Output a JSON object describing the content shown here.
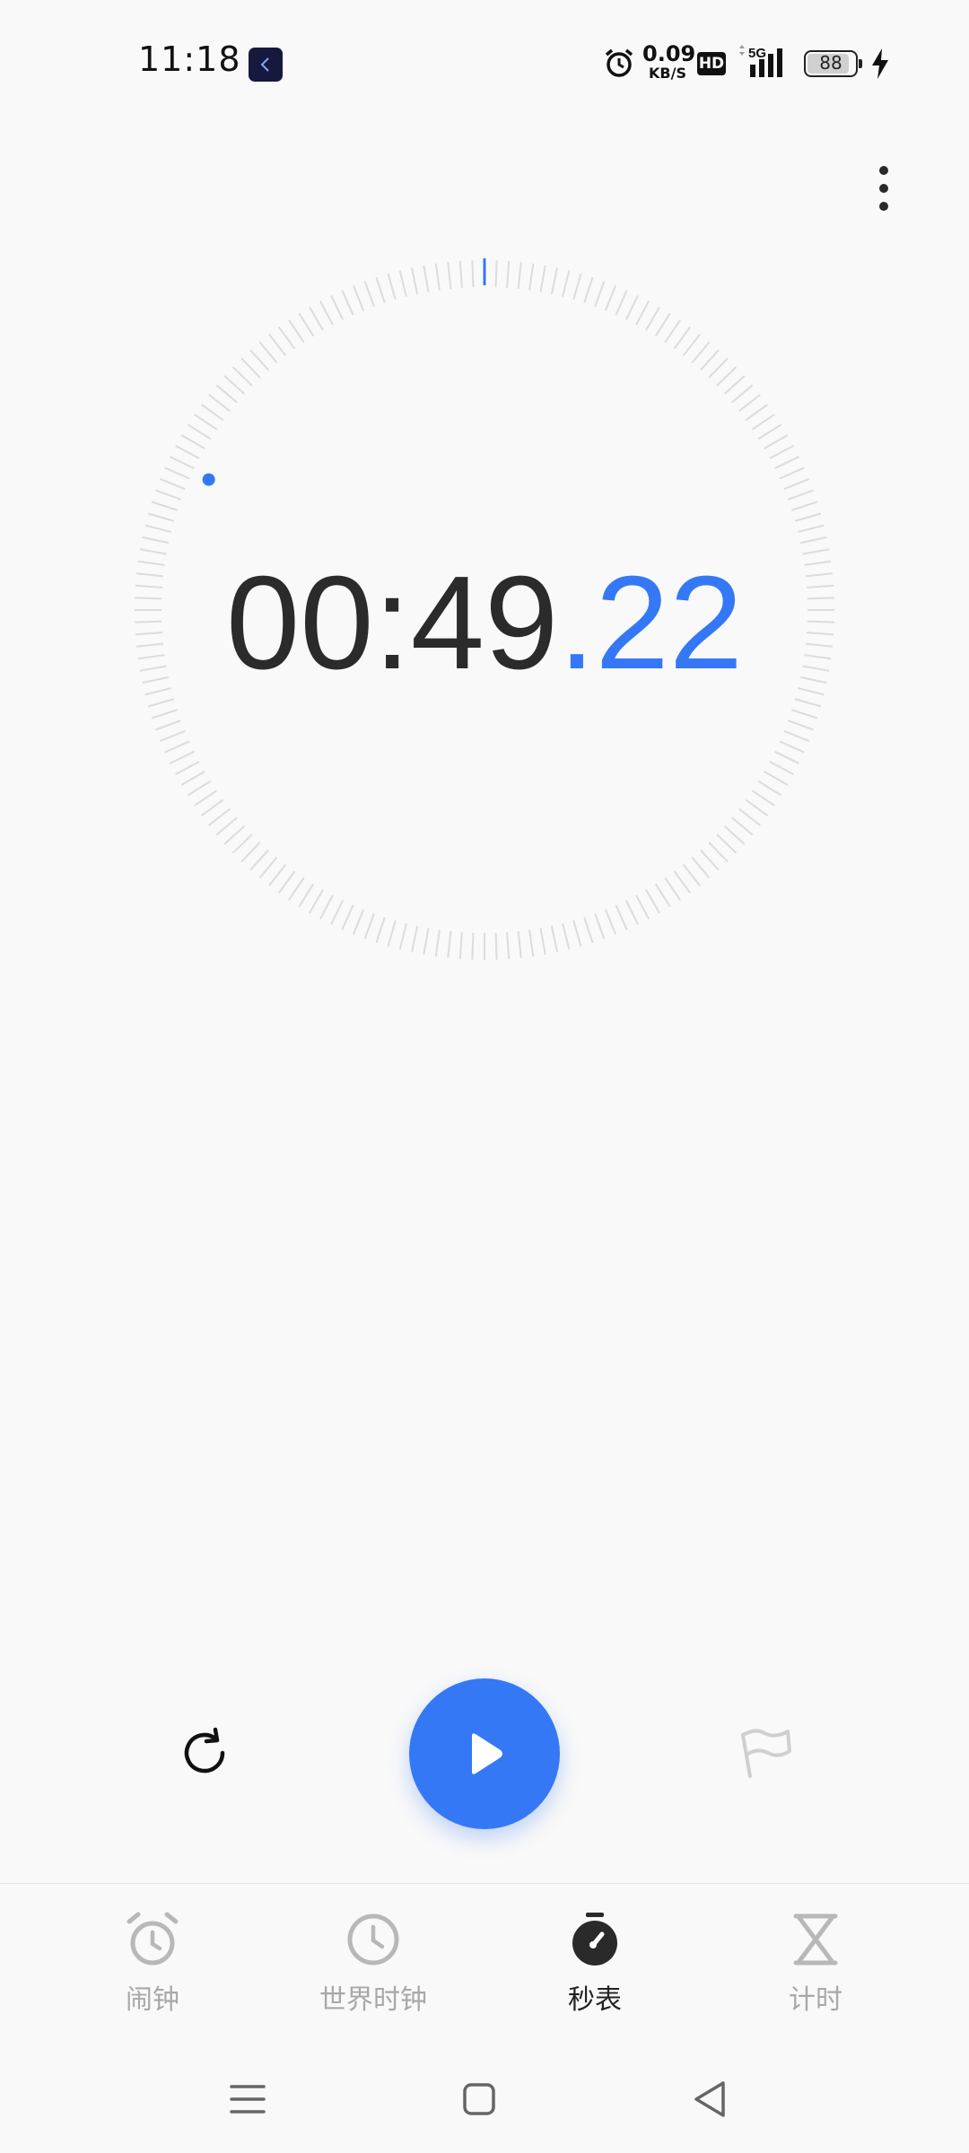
{
  "status_bar": {
    "time": "11:18",
    "net_speed_value": "0.09",
    "net_speed_unit": "KB/S",
    "hd_label": "HD",
    "network": "5G",
    "battery_percent": "88",
    "icons": [
      "app-notification-icon",
      "alarm-icon",
      "signal-icon",
      "battery-icon",
      "charging-icon"
    ]
  },
  "stopwatch": {
    "time_main": "00:49",
    "time_dot": ".",
    "time_fraction": "22",
    "accent_color": "#3478f6"
  },
  "controls": {
    "reset_icon": "reset-icon",
    "play_icon": "play-icon",
    "lap_icon": "flag-icon"
  },
  "bottom_nav": {
    "items": [
      {
        "label": "闹钟",
        "icon": "alarm-clock-icon",
        "active": false
      },
      {
        "label": "世界时钟",
        "icon": "world-clock-icon",
        "active": false
      },
      {
        "label": "秒表",
        "icon": "stopwatch-icon",
        "active": true
      },
      {
        "label": "计时",
        "icon": "hourglass-icon",
        "active": false
      }
    ]
  },
  "system_nav": {
    "icons": [
      "menu-icon",
      "home-icon",
      "back-icon"
    ]
  }
}
